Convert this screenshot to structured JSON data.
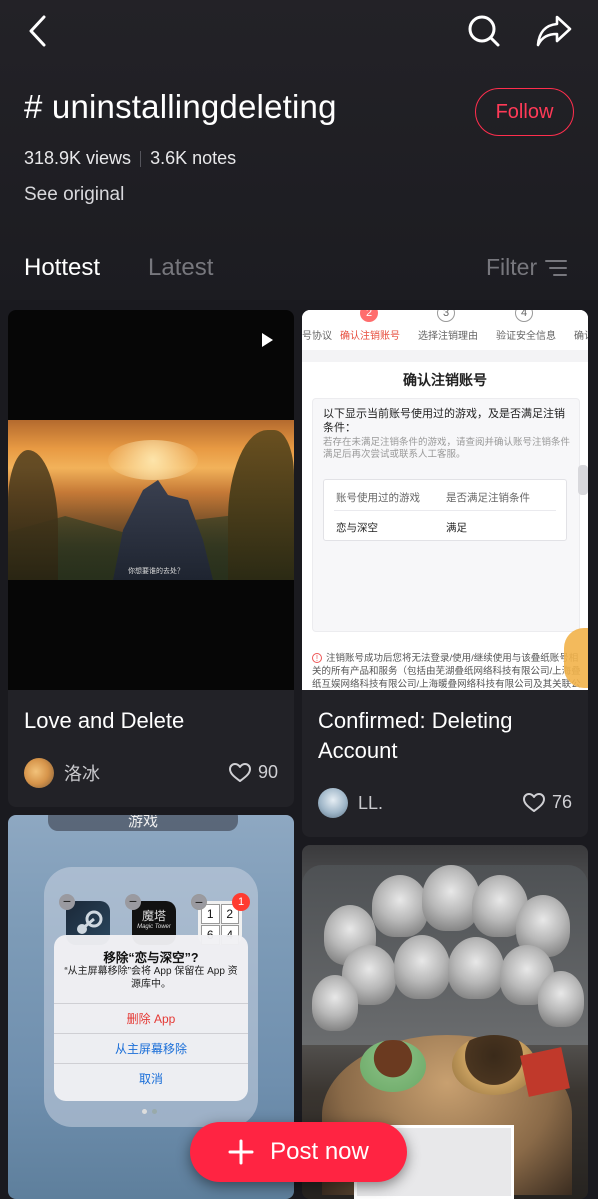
{
  "header": {
    "hashtag": "# uninstallingdeleting",
    "follow_label": "Follow",
    "views": "318.9K views",
    "notes": "3.6K notes",
    "see_original": "See original"
  },
  "tabs": {
    "hottest": "Hottest",
    "latest": "Latest",
    "filter": "Filter",
    "active": "Hottest"
  },
  "cards": [
    {
      "title": "Love and Delete",
      "author": "洛冰",
      "likes": "90",
      "media_type": "video",
      "subtitle_text": "你想要谁的去处？"
    },
    {
      "title": "Confirmed: Deleting Account",
      "author": "LL.",
      "likes": "76",
      "screenshot": {
        "steps": [
          {
            "num": "",
            "label": "号协议"
          },
          {
            "num": "2",
            "label": "确认注销账号"
          },
          {
            "num": "3",
            "label": "选择注销理由"
          },
          {
            "num": "4",
            "label": "验证安全信息"
          },
          {
            "num": "",
            "label": "确认"
          }
        ],
        "sheet_title": "确认注销账号",
        "question": "以下显示当前账号使用过的游戏，及是否满足注销条件：",
        "hint": "若存在未满足注销条件的游戏，请查阅并确认账号注销条件满足后再次尝试或联系人工客服。",
        "col1": "账号使用过的游戏",
        "col2": "是否满足注销条件",
        "game": "恋与深空",
        "status": "满足",
        "warning": "注销账号成功后您将无法登录/使用/继续使用与该叠纸账号相关的所有产品和服务（包括由芜湖叠纸网络科技有限公司/上海叠纸互娱网络科技有限公司/上海暖叠网络科技有限公司及其关联公司运"
      }
    },
    {
      "title": "",
      "author": "",
      "likes": "",
      "screenshot": {
        "folder_name": "游戏",
        "app2_name": "魔塔",
        "app2_sub": "Magic Tower",
        "app3_digits": [
          "1",
          "2",
          "6",
          "4"
        ],
        "badge": "1",
        "alert_title": "移除“恋与深空”?",
        "alert_body": "“从主屏幕移除”会将 App 保留在 App 资源库中。",
        "opt_delete": "删除 App",
        "opt_remove": "从主屏幕移除",
        "opt_cancel": "取消"
      }
    },
    {
      "title": "",
      "author": "",
      "likes": "",
      "media_type": "photo"
    }
  ],
  "post_button": "Post now",
  "colors": {
    "accent": "#ff2442",
    "background": "#1a1a1f",
    "card": "#222227",
    "muted_text": "#77777d"
  },
  "icons": [
    "back-icon",
    "search-icon",
    "share-icon",
    "filter-icon",
    "play-icon",
    "heart-icon",
    "plus-icon"
  ]
}
